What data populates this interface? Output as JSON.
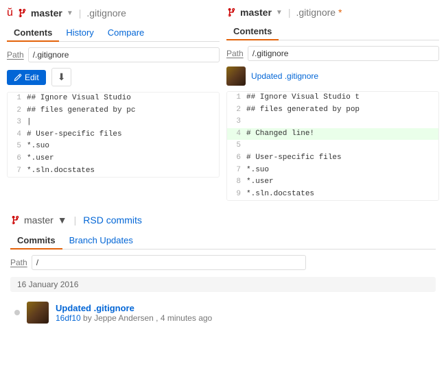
{
  "left_panel": {
    "branch_icon": "ꙮ",
    "branch_name": "master",
    "file_name": ".gitignore",
    "tabs": [
      {
        "label": "Contents",
        "active": true
      },
      {
        "label": "History",
        "active": false
      },
      {
        "label": "Compare",
        "active": false
      }
    ],
    "path_label": "Path",
    "path_value": "/.gitignore",
    "edit_label": "Edit",
    "download_icon": "⬇",
    "code_lines": [
      {
        "num": "1",
        "content": "## Ignore Visual Studio",
        "type": "normal"
      },
      {
        "num": "2",
        "content": "## files generated by pc",
        "type": "normal"
      },
      {
        "num": "3",
        "content": "|",
        "type": "cursor"
      },
      {
        "num": "4",
        "content": "# User-specific files",
        "type": "normal"
      },
      {
        "num": "5",
        "content": "*.suo",
        "type": "normal"
      },
      {
        "num": "6",
        "content": "*.user",
        "type": "normal"
      },
      {
        "num": "7",
        "content": "*.sln.docstates",
        "type": "normal"
      }
    ]
  },
  "right_panel": {
    "branch_name": "master",
    "file_name": ".gitignore",
    "modified": true,
    "tabs": [
      {
        "label": "Contents",
        "active": true
      }
    ],
    "path_label": "Path",
    "path_value": "/.gitignore",
    "commit_message": "Updated .gitignore",
    "code_lines": [
      {
        "num": "1",
        "content": "## Ignore Visual Studio t",
        "type": "normal"
      },
      {
        "num": "2",
        "content": "## files generated by pop",
        "type": "normal"
      },
      {
        "num": "3",
        "content": "",
        "type": "normal"
      },
      {
        "num": "4",
        "content": "# Changed line!",
        "type": "added"
      },
      {
        "num": "5",
        "content": "",
        "type": "normal"
      },
      {
        "num": "6",
        "content": "# User-specific files",
        "type": "normal"
      },
      {
        "num": "7",
        "content": "*.suo",
        "type": "normal"
      },
      {
        "num": "8",
        "content": "*.user",
        "type": "normal"
      },
      {
        "num": "9",
        "content": "*.sln.docstates",
        "type": "normal"
      }
    ]
  },
  "bottom_section": {
    "branch_name": "master",
    "repo_name": "RSD commits",
    "tabs": [
      {
        "label": "Commits",
        "active": true
      },
      {
        "label": "Branch Updates",
        "active": false
      }
    ],
    "path_label": "Path",
    "path_value": "/",
    "date_group": "16 January 2016",
    "commits": [
      {
        "title": "Updated .gitignore",
        "hash": "16df10",
        "author": "Jeppe Andersen",
        "time_ago": "4 minutes ago"
      }
    ]
  }
}
